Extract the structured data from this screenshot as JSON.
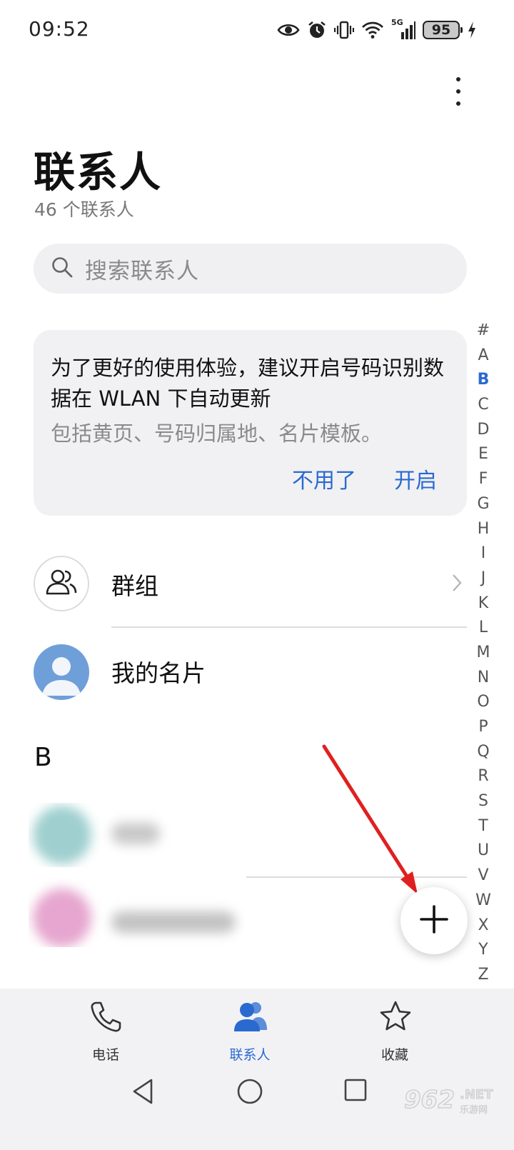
{
  "status_bar": {
    "time": "09:52",
    "network": "5G",
    "battery": "95",
    "icons": [
      "eye-icon",
      "alarm-icon",
      "vibrate-icon",
      "wifi-icon",
      "signal-icon",
      "battery-icon",
      "charging-icon"
    ]
  },
  "header": {
    "title": "联系人",
    "count_label": "46 个联系人",
    "menu_icon": "more-vertical-icon"
  },
  "search": {
    "placeholder": "搜索联系人",
    "icon": "search-icon"
  },
  "promo_card": {
    "message": "为了更好的使用体验，建议开启号码识别数据在 WLAN 下自动更新",
    "detail": "包括黄页、号码归属地、名片模板。",
    "dismiss_label": "不用了",
    "enable_label": "开启"
  },
  "list": {
    "groups_label": "群组",
    "my_card_label": "我的名片",
    "section_letter": "B"
  },
  "index_bar": {
    "letters": [
      "#",
      "A",
      "B",
      "C",
      "D",
      "E",
      "F",
      "G",
      "H",
      "I",
      "J",
      "K",
      "L",
      "M",
      "N",
      "O",
      "P",
      "Q",
      "R",
      "S",
      "T",
      "U",
      "V",
      "W",
      "X",
      "Y",
      "Z"
    ],
    "active": "B"
  },
  "fab": {
    "icon": "plus-icon"
  },
  "tabs": [
    {
      "label": "电话",
      "icon": "phone-icon",
      "selected": false
    },
    {
      "label": "联系人",
      "icon": "contacts-icon",
      "selected": true
    },
    {
      "label": "收藏",
      "icon": "star-icon",
      "selected": false
    }
  ],
  "nav_bar": {
    "icons": [
      "back-icon",
      "home-icon",
      "recents-icon"
    ]
  },
  "watermark": {
    "main": "962",
    "suffix": ".NET",
    "cn": "乐游网"
  },
  "colors": {
    "accent": "#2a6ad0",
    "annotation_arrow": "#e02020",
    "card_bg": "#f1f1f3",
    "tabbar_bg": "#f2f2f5"
  }
}
